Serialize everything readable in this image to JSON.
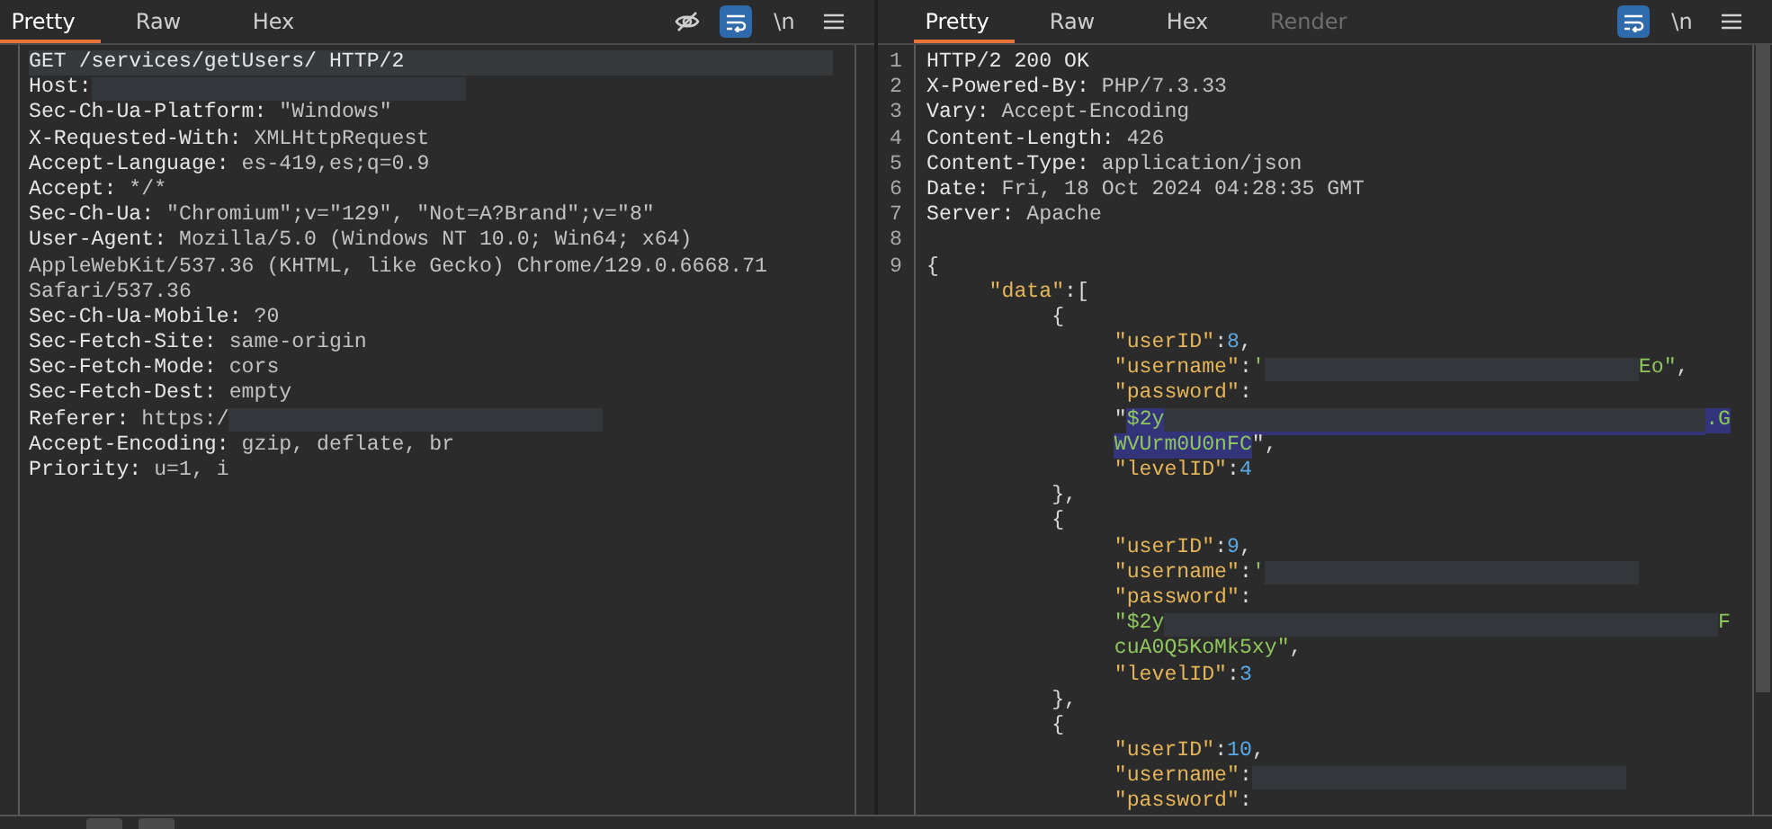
{
  "request": {
    "tabs": [
      {
        "label": "Pretty",
        "selected": true,
        "disabled": false
      },
      {
        "label": "Raw",
        "selected": false,
        "disabled": false
      },
      {
        "label": "Hex",
        "selected": false,
        "disabled": false
      }
    ],
    "tools": [
      {
        "kind": "eye",
        "selected": false
      },
      {
        "kind": "wrap",
        "selected": true
      },
      {
        "kind": "newline",
        "label": "\\n"
      },
      {
        "kind": "menu"
      }
    ],
    "lines": [
      {
        "current": true,
        "segments": [
          {
            "kind": "name",
            "text": "GET /services/getUsers/ HTTP/2"
          }
        ]
      },
      {
        "current": false,
        "segments": [
          {
            "kind": "name",
            "text": "Host:"
          },
          {
            "kind": "redacted"
          }
        ]
      },
      {
        "current": false,
        "segments": [
          {
            "kind": "name",
            "text": "Sec-Ch-Ua-Platform:"
          },
          {
            "kind": "value",
            "text": " \"Windows\""
          }
        ]
      },
      {
        "current": false,
        "segments": [
          {
            "kind": "name",
            "text": "X-Requested-With:"
          },
          {
            "kind": "value",
            "text": " XMLHttpRequest"
          }
        ]
      },
      {
        "current": false,
        "segments": [
          {
            "kind": "name",
            "text": "Accept-Language:"
          },
          {
            "kind": "value",
            "text": " es-419,es;q=0.9"
          }
        ]
      },
      {
        "current": false,
        "segments": [
          {
            "kind": "name",
            "text": "Accept:"
          },
          {
            "kind": "value",
            "text": " */*"
          }
        ]
      },
      {
        "current": false,
        "segments": [
          {
            "kind": "name",
            "text": "Sec-Ch-Ua:"
          },
          {
            "kind": "value",
            "text": " \"Chromium\";v=\"129\", \"Not=A?Brand\";v=\"8\""
          }
        ]
      },
      {
        "current": false,
        "segments": [
          {
            "kind": "name",
            "text": "User-Agent:"
          },
          {
            "kind": "value",
            "text": " Mozilla/5.0 (Windows NT 10.0; Win64; x64)"
          }
        ]
      },
      {
        "current": false,
        "segments": [
          {
            "kind": "value",
            "text": "AppleWebKit/537.36 (KHTML, like Gecko) Chrome/129.0.6668.71"
          }
        ]
      },
      {
        "current": false,
        "segments": [
          {
            "kind": "value",
            "text": "Safari/537.36"
          }
        ]
      },
      {
        "current": false,
        "segments": [
          {
            "kind": "name",
            "text": "Sec-Ch-Ua-Mobile:"
          },
          {
            "kind": "value",
            "text": " ?0"
          }
        ]
      },
      {
        "current": false,
        "segments": [
          {
            "kind": "name",
            "text": "Sec-Fetch-Site:"
          },
          {
            "kind": "value",
            "text": " same-origin"
          }
        ]
      },
      {
        "current": false,
        "segments": [
          {
            "kind": "name",
            "text": "Sec-Fetch-Mode:"
          },
          {
            "kind": "value",
            "text": " cors"
          }
        ]
      },
      {
        "current": false,
        "segments": [
          {
            "kind": "name",
            "text": "Sec-Fetch-Dest:"
          },
          {
            "kind": "value",
            "text": " empty"
          }
        ]
      },
      {
        "current": false,
        "segments": [
          {
            "kind": "name",
            "text": "Referer:"
          },
          {
            "kind": "value",
            "text": " https:/"
          },
          {
            "kind": "redacted"
          }
        ]
      },
      {
        "current": false,
        "segments": [
          {
            "kind": "name",
            "text": "Accept-Encoding:"
          },
          {
            "kind": "value",
            "text": " gzip, deflate, br"
          }
        ]
      },
      {
        "current": false,
        "segments": [
          {
            "kind": "name",
            "text": "Priority:"
          },
          {
            "kind": "value",
            "text": " u=1, i"
          }
        ]
      }
    ]
  },
  "response": {
    "tabs": [
      {
        "label": "Pretty",
        "selected": true,
        "disabled": false
      },
      {
        "label": "Raw",
        "selected": false,
        "disabled": false
      },
      {
        "label": "Hex",
        "selected": false,
        "disabled": false
      },
      {
        "label": "Render",
        "selected": false,
        "disabled": true
      }
    ],
    "tools": [
      {
        "kind": "wrap",
        "selected": true
      },
      {
        "kind": "newline",
        "label": "\\n"
      },
      {
        "kind": "menu"
      }
    ],
    "lines": [
      {
        "number": "1",
        "selected": false,
        "segments": [
          {
            "kind": "name",
            "text": "HTTP/2 200 OK"
          }
        ]
      },
      {
        "number": "2",
        "selected": false,
        "segments": [
          {
            "kind": "name",
            "text": "X-Powered-By:"
          },
          {
            "kind": "value",
            "text": " PHP/7.3.33"
          }
        ]
      },
      {
        "number": "3",
        "selected": false,
        "segments": [
          {
            "kind": "name",
            "text": "Vary:"
          },
          {
            "kind": "value",
            "text": " Accept-Encoding"
          }
        ]
      },
      {
        "number": "4",
        "selected": false,
        "segments": [
          {
            "kind": "name",
            "text": "Content-Length:"
          },
          {
            "kind": "value",
            "text": " 426"
          }
        ]
      },
      {
        "number": "5",
        "selected": false,
        "segments": [
          {
            "kind": "name",
            "text": "Content-Type:"
          },
          {
            "kind": "value",
            "text": " application/json"
          }
        ]
      },
      {
        "number": "6",
        "selected": false,
        "segments": [
          {
            "kind": "name",
            "text": "Date:"
          },
          {
            "kind": "value",
            "text": " Fri, 18 Oct 2024 04:28:35 GMT"
          }
        ]
      },
      {
        "number": "7",
        "selected": false,
        "segments": [
          {
            "kind": "name",
            "text": "Server:"
          },
          {
            "kind": "value",
            "text": " Apache"
          }
        ]
      },
      {
        "number": "8",
        "selected": false
      },
      {
        "number": "9",
        "selected": false,
        "segments": [
          {
            "kind": "punct",
            "text": "{"
          }
        ],
        "children": [
          {
            "selected": false,
            "segments": [
              {
                "kind": "key",
                "text": "\"data\""
              },
              {
                "kind": "punct",
                "text": ":["
              }
            ],
            "children": [
              {
                "selected": false,
                "segments": [
                  {
                    "kind": "punct",
                    "text": "{"
                  }
                ],
                "children": [
                  {
                    "selected": false,
                    "segments": [
                      {
                        "kind": "key",
                        "text": "\"userID\""
                      },
                      {
                        "kind": "punct",
                        "text": ":"
                      },
                      {
                        "kind": "number",
                        "text": "8"
                      },
                      {
                        "kind": "punct",
                        "text": ","
                      }
                    ]
                  },
                  {
                    "selected": false,
                    "segments": [
                      {
                        "kind": "key",
                        "text": "\"username\""
                      },
                      {
                        "kind": "punct",
                        "text": ":"
                      },
                      {
                        "kind": "string",
                        "text": "'"
                      },
                      {
                        "kind": "redacted"
                      },
                      {
                        "kind": "string",
                        "text": "Eo\""
                      },
                      {
                        "kind": "punct",
                        "text": ","
                      }
                    ]
                  },
                  {
                    "selected": false,
                    "segments": [
                      {
                        "kind": "key",
                        "text": "\"password\""
                      },
                      {
                        "kind": "punct",
                        "text": ":"
                      }
                    ]
                  },
                  {
                    "selected": true,
                    "segments": [
                      {
                        "kind": "punct",
                        "text": "\""
                      },
                      {
                        "kind": "string",
                        "text": "$2y"
                      },
                      {
                        "kind": "redacted-wide"
                      },
                      {
                        "kind": "string",
                        "text": ".G"
                      }
                    ]
                  },
                  {
                    "selected": true,
                    "segments": [
                      {
                        "kind": "string",
                        "text": "WVUrm0U0nFC"
                      },
                      {
                        "kind": "punct",
                        "text": "\","
                      }
                    ]
                  },
                  {
                    "selected": false,
                    "segments": [
                      {
                        "kind": "key",
                        "text": "\"levelID\""
                      },
                      {
                        "kind": "punct",
                        "text": ":"
                      },
                      {
                        "kind": "number",
                        "text": "4"
                      }
                    ]
                  }
                ]
              },
              {
                "selected": false,
                "segments": [
                  {
                    "kind": "punct",
                    "text": "},"
                  }
                ]
              },
              {
                "selected": false,
                "segments": [
                  {
                    "kind": "punct",
                    "text": "{"
                  }
                ],
                "children": [
                  {
                    "selected": false,
                    "segments": [
                      {
                        "kind": "key",
                        "text": "\"userID\""
                      },
                      {
                        "kind": "punct",
                        "text": ":"
                      },
                      {
                        "kind": "number",
                        "text": "9"
                      },
                      {
                        "kind": "punct",
                        "text": ","
                      }
                    ]
                  },
                  {
                    "selected": false,
                    "segments": [
                      {
                        "kind": "key",
                        "text": "\"username\""
                      },
                      {
                        "kind": "punct",
                        "text": ":"
                      },
                      {
                        "kind": "string",
                        "text": "'"
                      },
                      {
                        "kind": "redacted"
                      }
                    ]
                  },
                  {
                    "selected": false,
                    "segments": [
                      {
                        "kind": "key",
                        "text": "\"password\""
                      },
                      {
                        "kind": "punct",
                        "text": ":"
                      }
                    ]
                  },
                  {
                    "selected": false,
                    "segments": [
                      {
                        "kind": "string",
                        "text": "\"$2y"
                      },
                      {
                        "kind": "redacted-wide"
                      },
                      {
                        "kind": "string",
                        "text": "F"
                      }
                    ]
                  },
                  {
                    "selected": false,
                    "segments": [
                      {
                        "kind": "string",
                        "text": "cuA0Q5KoMk5xy\""
                      },
                      {
                        "kind": "punct",
                        "text": ","
                      }
                    ]
                  },
                  {
                    "selected": false,
                    "segments": [
                      {
                        "kind": "key",
                        "text": "\"levelID\""
                      },
                      {
                        "kind": "punct",
                        "text": ":"
                      },
                      {
                        "kind": "number",
                        "text": "3"
                      }
                    ]
                  }
                ]
              },
              {
                "selected": false,
                "segments": [
                  {
                    "kind": "punct",
                    "text": "},"
                  }
                ]
              },
              {
                "selected": false,
                "segments": [
                  {
                    "kind": "punct",
                    "text": "{"
                  }
                ],
                "children": [
                  {
                    "selected": false,
                    "segments": [
                      {
                        "kind": "key",
                        "text": "\"userID\""
                      },
                      {
                        "kind": "punct",
                        "text": ":"
                      },
                      {
                        "kind": "number",
                        "text": "10"
                      },
                      {
                        "kind": "punct",
                        "text": ","
                      }
                    ]
                  },
                  {
                    "selected": false,
                    "segments": [
                      {
                        "kind": "key",
                        "text": "\"username\""
                      },
                      {
                        "kind": "punct",
                        "text": ":"
                      },
                      {
                        "kind": "redacted"
                      }
                    ]
                  },
                  {
                    "selected": false,
                    "segments": [
                      {
                        "kind": "key",
                        "text": "\"password\""
                      },
                      {
                        "kind": "punct",
                        "text": ":"
                      }
                    ]
                  }
                ]
              }
            ]
          }
        ]
      }
    ]
  }
}
